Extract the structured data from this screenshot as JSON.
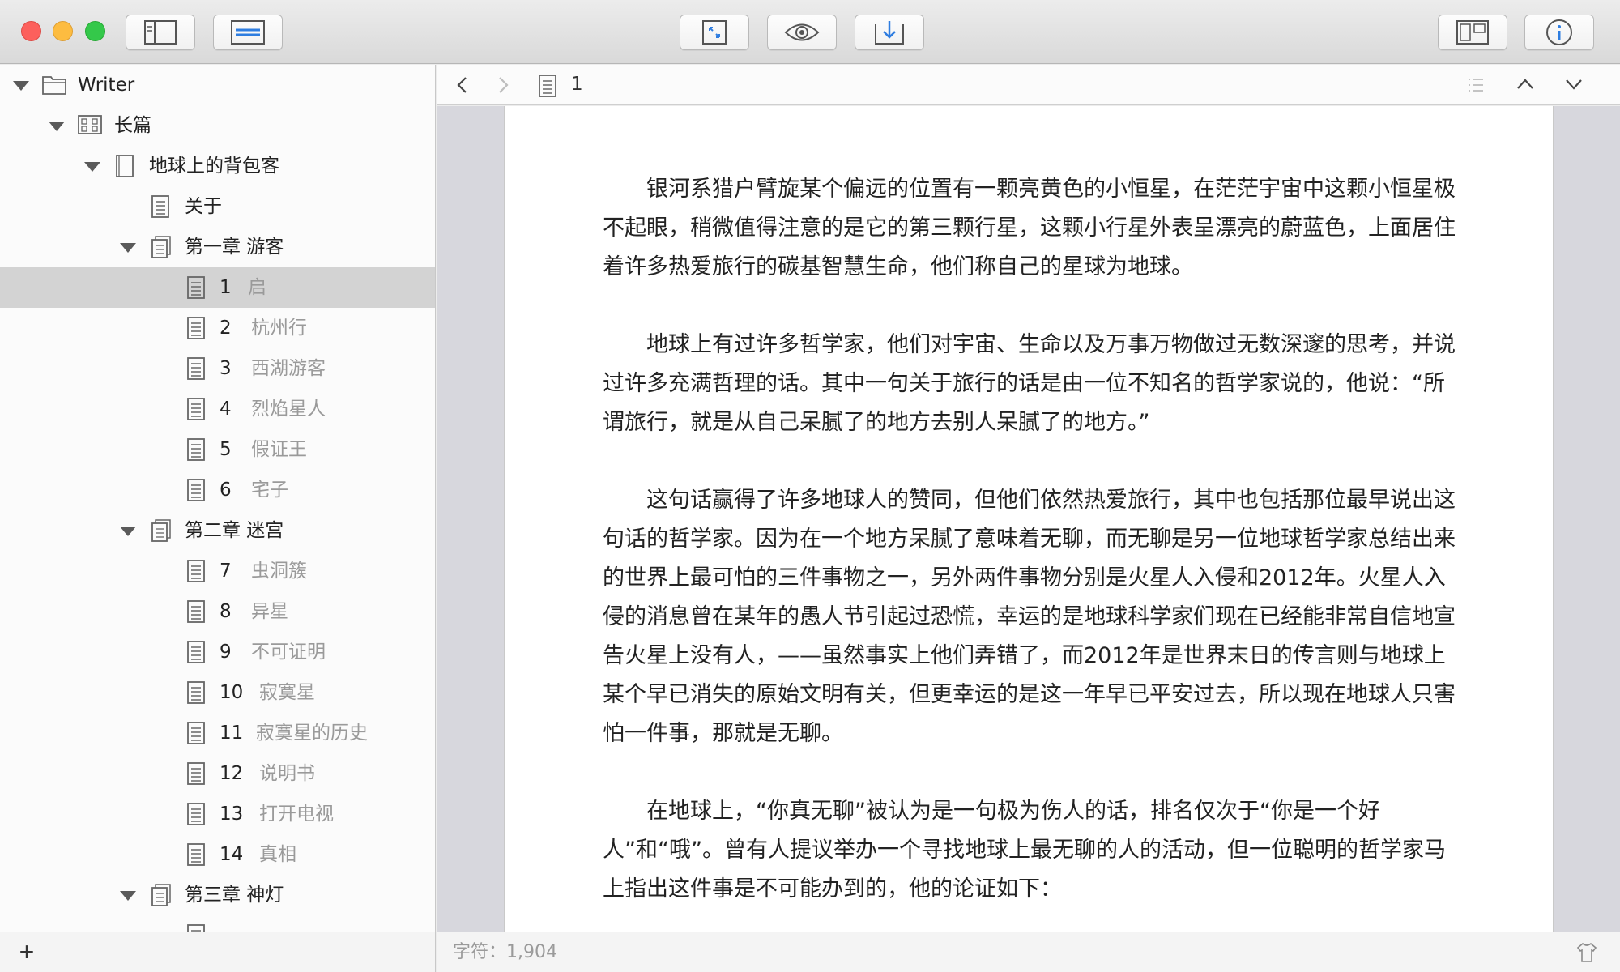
{
  "window": {
    "traffic_lights": [
      "close",
      "minimize",
      "zoom"
    ]
  },
  "toolbar": {
    "left_buttons": [
      {
        "name": "sidebar-toggle-button",
        "icon": "sidebar-icon"
      },
      {
        "name": "format-bar-button",
        "icon": "format-bar-icon"
      }
    ],
    "center_buttons": [
      {
        "name": "fullscreen-button",
        "icon": "expand-arrows-icon"
      },
      {
        "name": "preview-button",
        "icon": "eye-icon"
      },
      {
        "name": "export-button",
        "icon": "download-icon"
      }
    ],
    "right_buttons": [
      {
        "name": "split-view-button",
        "icon": "split-view-icon"
      },
      {
        "name": "info-button",
        "icon": "info-icon"
      }
    ]
  },
  "sidebar": {
    "items": [
      {
        "label": "Writer",
        "kind": "folder",
        "level": 0,
        "expanded": true
      },
      {
        "label": "长篇",
        "kind": "project",
        "level": 1,
        "expanded": true
      },
      {
        "label": "地球上的背包客",
        "kind": "book",
        "level": 2,
        "expanded": true
      },
      {
        "label": "关于",
        "kind": "document",
        "level": 3
      },
      {
        "label": "第一章 游客",
        "kind": "chapter",
        "level": 3,
        "expanded": true
      },
      {
        "num": "1",
        "title": "启",
        "kind": "document",
        "level": 4,
        "selected": true
      },
      {
        "num": "2",
        "title": "杭州行",
        "kind": "document",
        "level": 4
      },
      {
        "num": "3",
        "title": "西湖游客",
        "kind": "document",
        "level": 4
      },
      {
        "num": "4",
        "title": "烈焰星人",
        "kind": "document",
        "level": 4
      },
      {
        "num": "5",
        "title": "假证王",
        "kind": "document",
        "level": 4
      },
      {
        "num": "6",
        "title": "宅子",
        "kind": "document",
        "level": 4
      },
      {
        "label": "第二章 迷宫",
        "kind": "chapter",
        "level": 3,
        "expanded": true
      },
      {
        "num": "7",
        "title": "虫洞簇",
        "kind": "document",
        "level": 4
      },
      {
        "num": "8",
        "title": "异星",
        "kind": "document",
        "level": 4
      },
      {
        "num": "9",
        "title": "不可证明",
        "kind": "document",
        "level": 4
      },
      {
        "num": "10",
        "title": "寂寞星",
        "kind": "document",
        "level": 4
      },
      {
        "num": "11",
        "title": "寂寞星的历史",
        "kind": "document",
        "level": 4
      },
      {
        "num": "12",
        "title": "说明书",
        "kind": "document",
        "level": 4
      },
      {
        "num": "13",
        "title": "打开电视",
        "kind": "document",
        "level": 4
      },
      {
        "num": "14",
        "title": "真相",
        "kind": "document",
        "level": 4
      },
      {
        "label": "第三章 神灯",
        "kind": "chapter",
        "level": 3,
        "expanded": true
      }
    ],
    "add_label": "+"
  },
  "editor_header": {
    "back_icon": "chevron-left-icon",
    "forward_icon": "chevron-right-icon",
    "current_doc": "1",
    "outline_icon": "list-icon",
    "prev_icon": "chevron-up-icon",
    "next_icon": "chevron-down-icon"
  },
  "editor": {
    "paragraphs": [
      "银河系猎户臂旋某个偏远的位置有一颗亮黄色的小恒星，在茫茫宇宙中这颗小恒星极不起眼，稍微值得注意的是它的第三颗行星，这颗小行星外表呈漂亮的蔚蓝色，上面居住着许多热爱旅行的碳基智慧生命，他们称自己的星球为地球。",
      "地球上有过许多哲学家，他们对宇宙、生命以及万事万物做过无数深邃的思考，并说过许多充满哲理的话。其中一句关于旅行的话是由一位不知名的哲学家说的，他说：“所谓旅行，就是从自己呆腻了的地方去别人呆腻了的地方。”",
      "这句话赢得了许多地球人的赞同，但他们依然热爱旅行，其中也包括那位最早说出这句话的哲学家。因为在一个地方呆腻了意味着无聊，而无聊是另一位地球哲学家总结出来的世界上最可怕的三件事物之一，另外两件事物分别是火星人入侵和2012年。火星人入侵的消息曾在某年的愚人节引起过恐慌，幸运的是地球科学家们现在已经能非常自信地宣告火星上没有人，——虽然事实上他们弄错了，而2012年是世界末日的传言则与地球上某个早已消失的原始文明有关，但更幸运的是这一年早已平安过去，所以现在地球人只害怕一件事，那就是无聊。",
      "在地球上，“你真无聊”被认为是一句极为伤人的话，排名仅次于“你是一个好人”和“哦”。曾有人提议举办一个寻找地球上最无聊的人的活动，但一位聪明的哲学家马上指出这件事是不可能办到的，他的论证如下："
    ]
  },
  "status": {
    "char_count": "字符：1,904",
    "theme_icon": "shirt-icon"
  }
}
